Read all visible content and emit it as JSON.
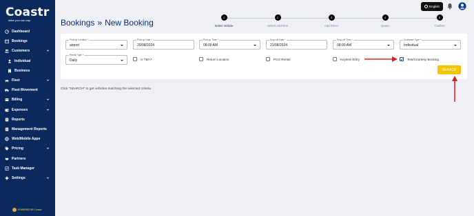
{
  "brand": {
    "name": "Coastr",
    "tagline": "Make your own way."
  },
  "sidebar": {
    "items": [
      {
        "label": "Dashboard",
        "icon": "dashboard-icon",
        "chevron": false,
        "sub": false
      },
      {
        "label": "Bookings",
        "icon": "calendar-icon",
        "chevron": false,
        "sub": false
      },
      {
        "label": "Customers",
        "icon": "users-icon",
        "chevron": true,
        "sub": false
      },
      {
        "label": "Individual",
        "icon": "user-icon",
        "chevron": false,
        "sub": true
      },
      {
        "label": "Business",
        "icon": "building-icon",
        "chevron": false,
        "sub": true
      },
      {
        "label": "Fleet",
        "icon": "car-icon",
        "chevron": true,
        "sub": false
      },
      {
        "label": "Fleet Movement",
        "icon": "truck-icon",
        "chevron": false,
        "sub": false
      },
      {
        "label": "Billing",
        "icon": "invoice-icon",
        "chevron": true,
        "sub": false
      },
      {
        "label": "Expenses",
        "icon": "wallet-icon",
        "chevron": true,
        "sub": false
      },
      {
        "label": "Reports",
        "icon": "report-icon",
        "chevron": false,
        "sub": false
      },
      {
        "label": "Management Reports",
        "icon": "report-icon",
        "chevron": false,
        "sub": false
      },
      {
        "label": "Web/Mobile Apps",
        "icon": "globe-icon",
        "chevron": false,
        "sub": false
      },
      {
        "label": "Pricing",
        "icon": "tag-icon",
        "chevron": true,
        "sub": false
      },
      {
        "label": "Partners",
        "icon": "handshake-icon",
        "chevron": false,
        "sub": false
      },
      {
        "label": "Task Manager",
        "icon": "tasks-icon",
        "chevron": false,
        "sub": false
      },
      {
        "label": "Settings",
        "icon": "gear-icon",
        "chevron": true,
        "sub": false
      }
    ],
    "footer": "POWERED BY Coastr"
  },
  "topbar": {
    "language": "English"
  },
  "page": {
    "title_part1": "Bookings",
    "separator": "»",
    "title_part2": "New Booking"
  },
  "stepper": [
    {
      "num": "1",
      "label": "Select Vehicle",
      "active": true
    },
    {
      "num": "2",
      "label": "Select Add-Ons",
      "active": false
    },
    {
      "num": "3",
      "label": "Add Driver",
      "active": false
    },
    {
      "num": "4",
      "label": "Quote",
      "active": false
    },
    {
      "num": "5",
      "label": "Confirm",
      "active": false
    }
  ],
  "form": {
    "pickup_location": {
      "label": "Pick-up Location *",
      "value": "airport"
    },
    "pickup_date": {
      "label": "Pick-up Date *",
      "value": "20/08/2024"
    },
    "pickup_time": {
      "label": "Pick-up Time *",
      "value": "08:00 AM"
    },
    "dropoff_date": {
      "label": "Drop-off Date *",
      "value": "21/08/2024"
    },
    "dropoff_time": {
      "label": "Drop-off Time *",
      "value": "08:00 AM"
    },
    "customer_type": {
      "label": "Customer Type *",
      "value": "Individual"
    },
    "rental_type": {
      "label": "Rental Type *",
      "value": "Daily"
    },
    "checkboxes": {
      "is_tba": {
        "label": "Is TBA?",
        "checked": false
      },
      "return_location": {
        "label": "Return Location",
        "checked": false
      },
      "pco_rental": {
        "label": "PCO Rental",
        "checked": false
      },
      "keyless_entry": {
        "label": "Keyless Entry",
        "checked": false
      },
      "test_courtesy": {
        "label": "Test/Courtesy Booking",
        "checked": true
      }
    },
    "search_label": "SEARCH"
  },
  "hint": "Click \"SEARCH\" to get vehicles matching the selected criteria",
  "colors": {
    "sidebar_bg": "#0a2a5e",
    "accent": "#f6c400",
    "title": "#0b2f6b",
    "annotation_arrow": "#e02020"
  }
}
